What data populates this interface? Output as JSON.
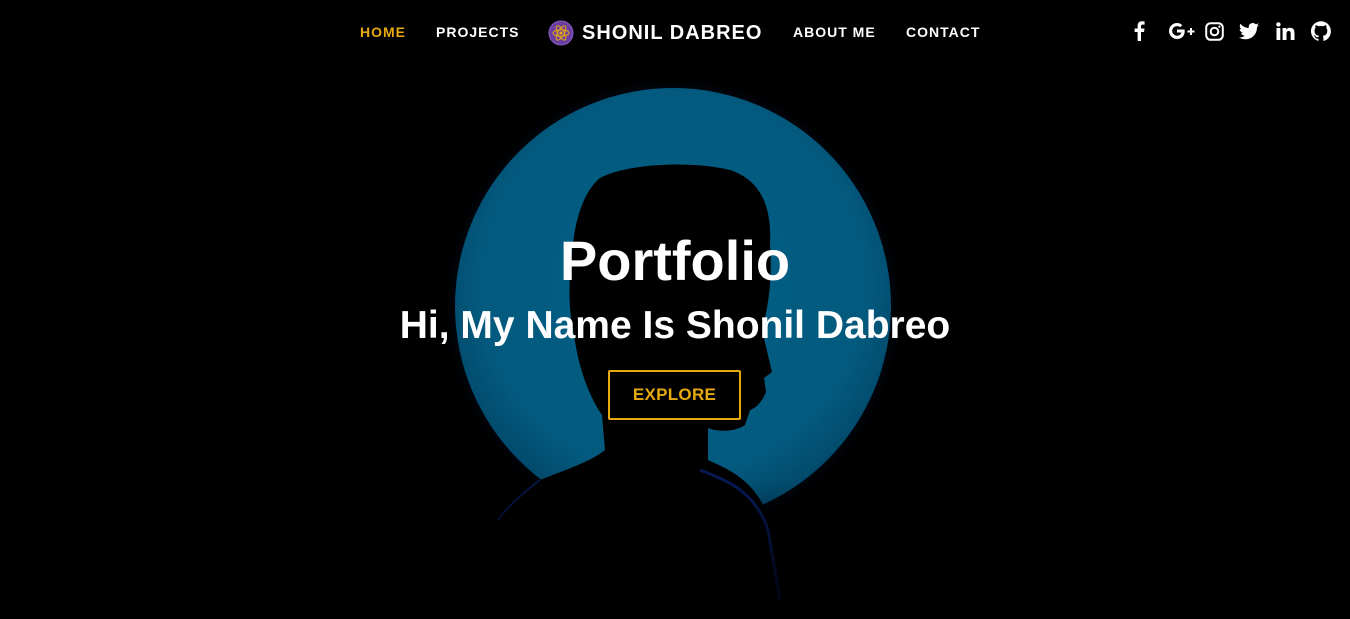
{
  "nav": {
    "items": [
      {
        "label": "HOME",
        "active": true
      },
      {
        "label": "PROJECTS",
        "active": false
      },
      {
        "label": "ABOUT ME",
        "active": false
      },
      {
        "label": "CONTACT",
        "active": false
      }
    ],
    "brand": {
      "name": "SHONIL DABREO",
      "logo_icon": "atom-logo-icon"
    },
    "social_icons": [
      "facebook-icon",
      "google-plus-icon",
      "instagram-icon",
      "twitter-icon",
      "linkedin-icon",
      "github-icon"
    ]
  },
  "hero": {
    "title": "Portfolio",
    "subtitle": "Hi, My Name Is Shonil Dabreo",
    "button_label": "EXPLORE"
  },
  "colors": {
    "accent": "#e6a90f",
    "background": "#000000",
    "circle": "#035a7e",
    "text": "#ffffff"
  }
}
